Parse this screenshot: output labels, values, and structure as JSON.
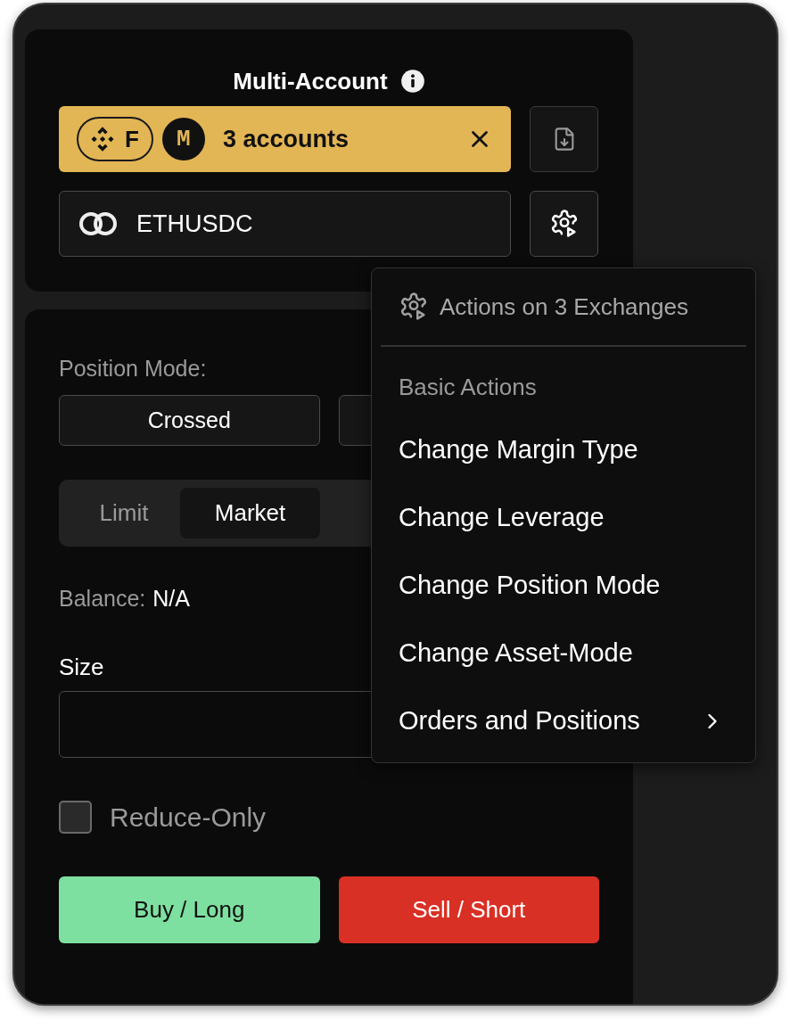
{
  "header": {
    "title": "Multi-Account"
  },
  "account_selector": {
    "exchange_badge": "F",
    "account_badge": "M",
    "label": "3 accounts"
  },
  "symbol": {
    "value": "ETHUSDC"
  },
  "position_mode": {
    "label": "Position Mode:",
    "options": [
      {
        "label": "Crossed"
      }
    ]
  },
  "order_types": [
    {
      "label": "Limit",
      "selected": false
    },
    {
      "label": "Market",
      "selected": true
    }
  ],
  "balance": {
    "label": "Balance:",
    "value": "N/A"
  },
  "size": {
    "label": "Size"
  },
  "reduce_only": {
    "label": "Reduce-Only",
    "checked": false
  },
  "buttons": [
    {
      "label": "Buy / Long",
      "kind": "buy"
    },
    {
      "label": "Sell / Short",
      "kind": "sell"
    }
  ],
  "menu": {
    "title": "Actions on 3 Exchanges",
    "section": "Basic Actions",
    "items": [
      {
        "label": "Change Margin Type",
        "submenu": false
      },
      {
        "label": "Change Leverage",
        "submenu": false
      },
      {
        "label": "Change Position Mode",
        "submenu": false
      },
      {
        "label": "Change Asset-Mode",
        "submenu": false
      },
      {
        "label": "Orders and Positions",
        "submenu": true
      }
    ]
  }
}
